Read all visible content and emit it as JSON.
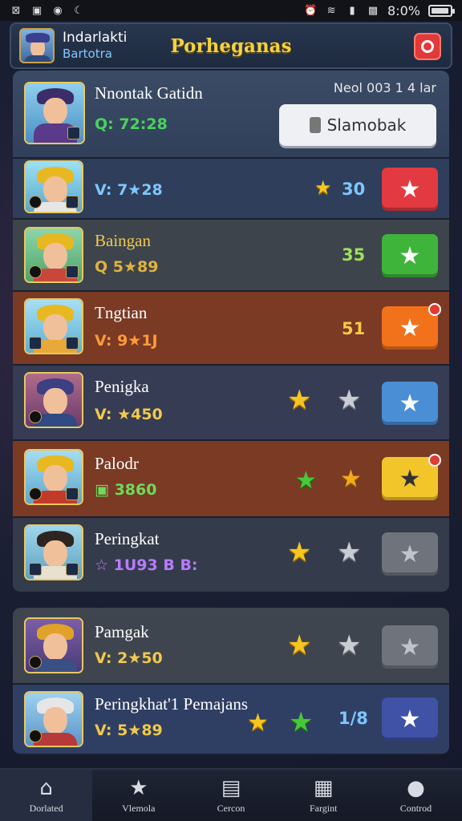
{
  "status_bar": {
    "time": "8:0%"
  },
  "header": {
    "user_name": "Indarlakti",
    "user_sub": "Bartotra",
    "title": "Porheganas"
  },
  "top_row": {
    "name": "Nnontak Gatidn",
    "stat": "Q: 72:28",
    "info": "Neol 003 1 4 lar",
    "button_label": "Slamobak"
  },
  "rows": [
    {
      "name": "",
      "stat": "V: 7★28",
      "score": "30"
    },
    {
      "name": "Baingan",
      "stat": "Q 5★89",
      "score": "35"
    },
    {
      "name": "Tngtian",
      "stat": "V: 9★1J",
      "score": "51"
    },
    {
      "name": "Penigka",
      "stat": "V: ★450",
      "score": ""
    },
    {
      "name": "Palodr",
      "stat": "▣ 3860",
      "score": ""
    },
    {
      "name": "Peringkat",
      "stat": "☆ 1U93 B B:",
      "score": ""
    },
    {
      "name": "Pamgak",
      "stat": "V: 2★50",
      "score": ""
    },
    {
      "name": "Peringkhat'1 Pemajans",
      "stat": "V: 5★89",
      "score": "1/8"
    }
  ],
  "nav": [
    {
      "label": "Dorlated",
      "icon": "home-icon"
    },
    {
      "label": "Vlemola",
      "icon": "star-badge-icon"
    },
    {
      "label": "Cercon",
      "icon": "card-icon"
    },
    {
      "label": "Fargint",
      "icon": "book-icon"
    },
    {
      "label": "Controd",
      "icon": "profile-icon"
    }
  ],
  "colors": {
    "title": "#f4d23b",
    "accent_red": "#e2393a",
    "accent_green": "#47c73a",
    "accent_orange": "#f2821c",
    "accent_blue": "#4a8fd6"
  }
}
